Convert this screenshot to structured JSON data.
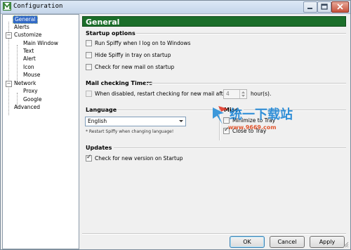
{
  "window": {
    "title": "Configuration",
    "controls": {
      "minimize": "minimize-icon",
      "maximize": "maximize-icon",
      "close": "close-icon"
    }
  },
  "tree": {
    "items": [
      {
        "label": "General",
        "selected": true
      },
      {
        "label": "Alerts"
      },
      {
        "label": "Customize",
        "expander": "−"
      },
      {
        "label": "Main Window"
      },
      {
        "label": "Text"
      },
      {
        "label": "Alert"
      },
      {
        "label": "Icon"
      },
      {
        "label": "Mouse"
      },
      {
        "label": "Network",
        "expander": "−"
      },
      {
        "label": "Proxy"
      },
      {
        "label": "Google"
      },
      {
        "label": "Advanced"
      }
    ]
  },
  "page": {
    "heading": "General",
    "startup": {
      "title": "Startup options",
      "options": [
        {
          "label": "Run Spiffy when I log on to Windows",
          "checked": false
        },
        {
          "label": "Hide Spiffy in tray on startup",
          "checked": false
        },
        {
          "label": "Check for new mail on startup",
          "checked": false
        }
      ]
    },
    "timers": {
      "title": "Mail checking Timers",
      "label": "When disabled, restart checking for new mail after",
      "value": "4",
      "unit": "hour(s).",
      "checked": false
    },
    "language": {
      "title": "Language",
      "selected": "English",
      "note": "* Restart Spiffy when changing language!"
    },
    "misc": {
      "title": "Misc.",
      "options": [
        {
          "label": "Minimize to Tray",
          "checked": false
        },
        {
          "label": "Close to Tray",
          "checked": true
        }
      ]
    },
    "updates": {
      "title": "Updates",
      "option": {
        "label": "Check for new version on Startup",
        "checked": true
      }
    }
  },
  "buttons": {
    "ok": "OK",
    "cancel": "Cancel",
    "apply": "Apply"
  },
  "watermark": {
    "brand": "统一下载站",
    "site": "www.9669.com"
  }
}
